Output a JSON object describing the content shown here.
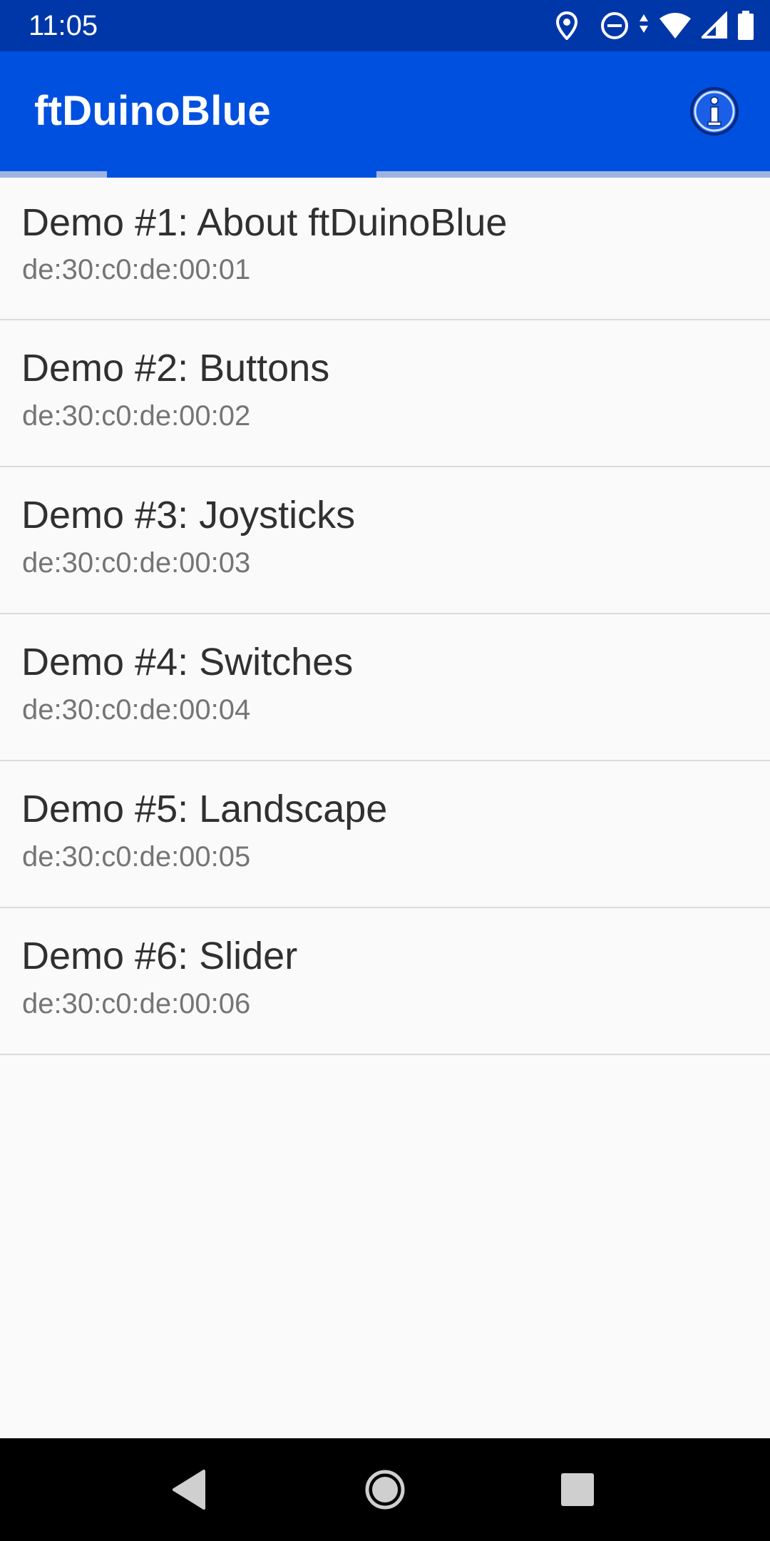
{
  "status_bar": {
    "time": "11:05",
    "icons": [
      "location-icon",
      "do-not-disturb-icon",
      "data-arrows-icon",
      "wifi-icon",
      "cell-signal-icon",
      "battery-icon"
    ]
  },
  "app_bar": {
    "title": "ftDuinoBlue",
    "info_icon": "info-icon"
  },
  "devices": [
    {
      "name": "Demo #1: About ftDuinoBlue",
      "address": "de:30:c0:de:00:01"
    },
    {
      "name": "Demo #2: Buttons",
      "address": "de:30:c0:de:00:02"
    },
    {
      "name": "Demo #3: Joysticks",
      "address": "de:30:c0:de:00:03"
    },
    {
      "name": "Demo #4: Switches",
      "address": "de:30:c0:de:00:04"
    },
    {
      "name": "Demo #5: Landscape",
      "address": "de:30:c0:de:00:05"
    },
    {
      "name": "Demo #6: Slider",
      "address": "de:30:c0:de:00:06"
    }
  ],
  "nav_bar": {
    "icons": [
      "back-icon",
      "home-icon",
      "recents-icon"
    ]
  },
  "colors": {
    "status_bar": "#0037a8",
    "app_bar": "#0050e0",
    "indicator_track": "#9fb3e3",
    "background": "#fafafa",
    "primary_text": "#303030",
    "secondary_text": "#757575",
    "divider": "#dcdcdc"
  }
}
